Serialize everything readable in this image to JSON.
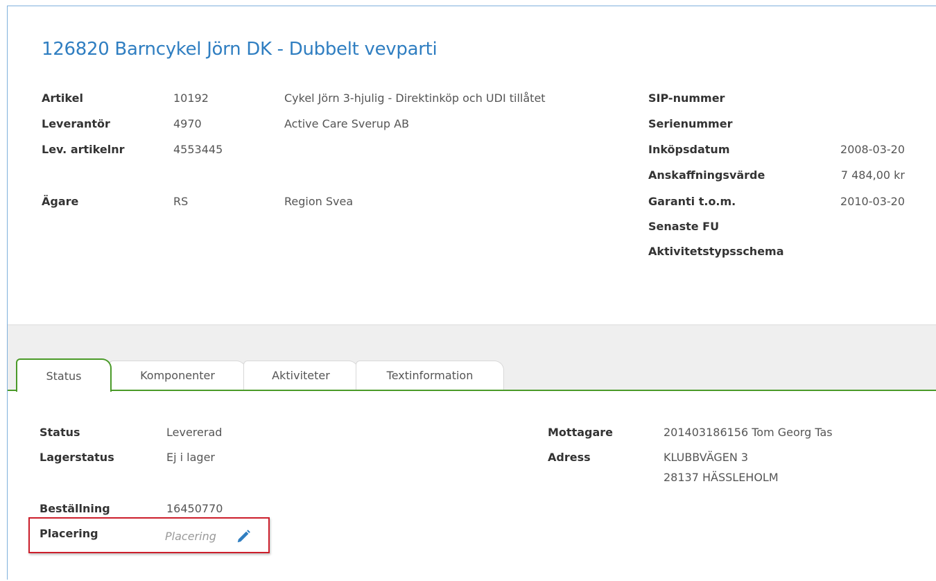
{
  "header": {
    "title": "126820 Barncykel Jörn DK - Dubbelt vevparti"
  },
  "details_left": [
    {
      "label": "Artikel",
      "code": "10192",
      "desc": "Cykel Jörn 3-hjulig - Direktinköp och UDI tillåtet"
    },
    {
      "label": "Leverantör",
      "code": "4970",
      "desc": "Active Care Sverup AB"
    },
    {
      "label": "Lev. artikelnr",
      "code": "4553445",
      "desc": ""
    },
    {
      "label": "Ägare",
      "code": "RS",
      "desc": "Region Svea"
    }
  ],
  "details_right": [
    {
      "label": "SIP-nummer",
      "value": ""
    },
    {
      "label": "Serienummer",
      "value": ""
    },
    {
      "label": "Inköpsdatum",
      "value": "2008-03-20"
    },
    {
      "label": "Anskaffningsvärde",
      "value": "7 484,00 kr"
    },
    {
      "label": "Garanti t.o.m.",
      "value": "2010-03-20"
    },
    {
      "label": "Senaste FU",
      "value": ""
    },
    {
      "label": "Aktivitetstypsschema",
      "value": ""
    }
  ],
  "tabs": [
    {
      "label": "Status",
      "active": true
    },
    {
      "label": "Komponenter",
      "active": false
    },
    {
      "label": "Aktiviteter",
      "active": false
    },
    {
      "label": "Textinformation",
      "active": false
    }
  ],
  "status_panel": {
    "status_label": "Status",
    "status_value": "Levererad",
    "lagerstatus_label": "Lagerstatus",
    "lagerstatus_value": "Ej i lager",
    "bestallning_label": "Beställning",
    "bestallning_value": "16450770",
    "placering_label": "Placering",
    "placering_placeholder": "Placering",
    "mottagare_label": "Mottagare",
    "mottagare_value": "201403186156 Tom Georg Tas",
    "adress_label": "Adress",
    "adress_line1": "KLUBBVÄGEN 3",
    "adress_line2": "28137 HÄSSLEHOLM"
  },
  "colors": {
    "title": "#2f7ec1",
    "tab_active_border": "#4a9a28",
    "highlight_box": "#cc1e2b",
    "edit_icon": "#2f7ec1"
  },
  "icons": {
    "edit": "pencil-icon"
  }
}
